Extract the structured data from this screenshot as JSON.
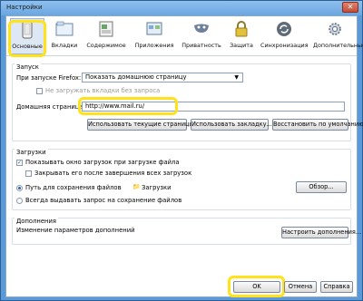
{
  "window": {
    "title": "Настройки",
    "close_glyph": "✕"
  },
  "toolbar": {
    "items": [
      {
        "label": "Основные",
        "icon": "phone-icon"
      },
      {
        "label": "Вкладки",
        "icon": "tabs-icon"
      },
      {
        "label": "Содержимое",
        "icon": "content-icon"
      },
      {
        "label": "Приложения",
        "icon": "applications-icon"
      },
      {
        "label": "Приватность",
        "icon": "privacy-mask-icon"
      },
      {
        "label": "Защита",
        "icon": "lock-icon"
      },
      {
        "label": "Синхронизация",
        "icon": "sync-icon"
      },
      {
        "label": "Дополнительные",
        "icon": "gear-icon"
      }
    ]
  },
  "startup": {
    "group_title": "Запуск",
    "on_start_label": "При запуске Firefox:",
    "on_start_value": "Показать домашнюю страницу",
    "no_load_tabs_label": "Не загружать вкладки без запроса",
    "homepage_label": "Домашняя страница:",
    "homepage_value": "http://www.mail.ru/",
    "use_current_button": "Использовать текущие страницы",
    "use_bookmark_button": "Использовать закладку...",
    "restore_default_button": "Восстановить по умолчанию"
  },
  "downloads": {
    "group_title": "Загрузки",
    "show_window_label": "Показывать окно загрузок при загрузке файла",
    "close_when_done_label": "Закрывать его после завершения всех загрузок",
    "save_path_label": "Путь для сохранения файлов",
    "folder_name": "Загрузки",
    "browse_button": "Обзор...",
    "always_ask_label": "Всегда выдавать запрос на сохранение файлов"
  },
  "addons": {
    "group_title": "Дополнения",
    "description": "Изменение параметров дополнений",
    "configure_button": "Настроить дополнения..."
  },
  "footer": {
    "ok": "OK",
    "cancel": "Отмена",
    "help": "Справка"
  }
}
